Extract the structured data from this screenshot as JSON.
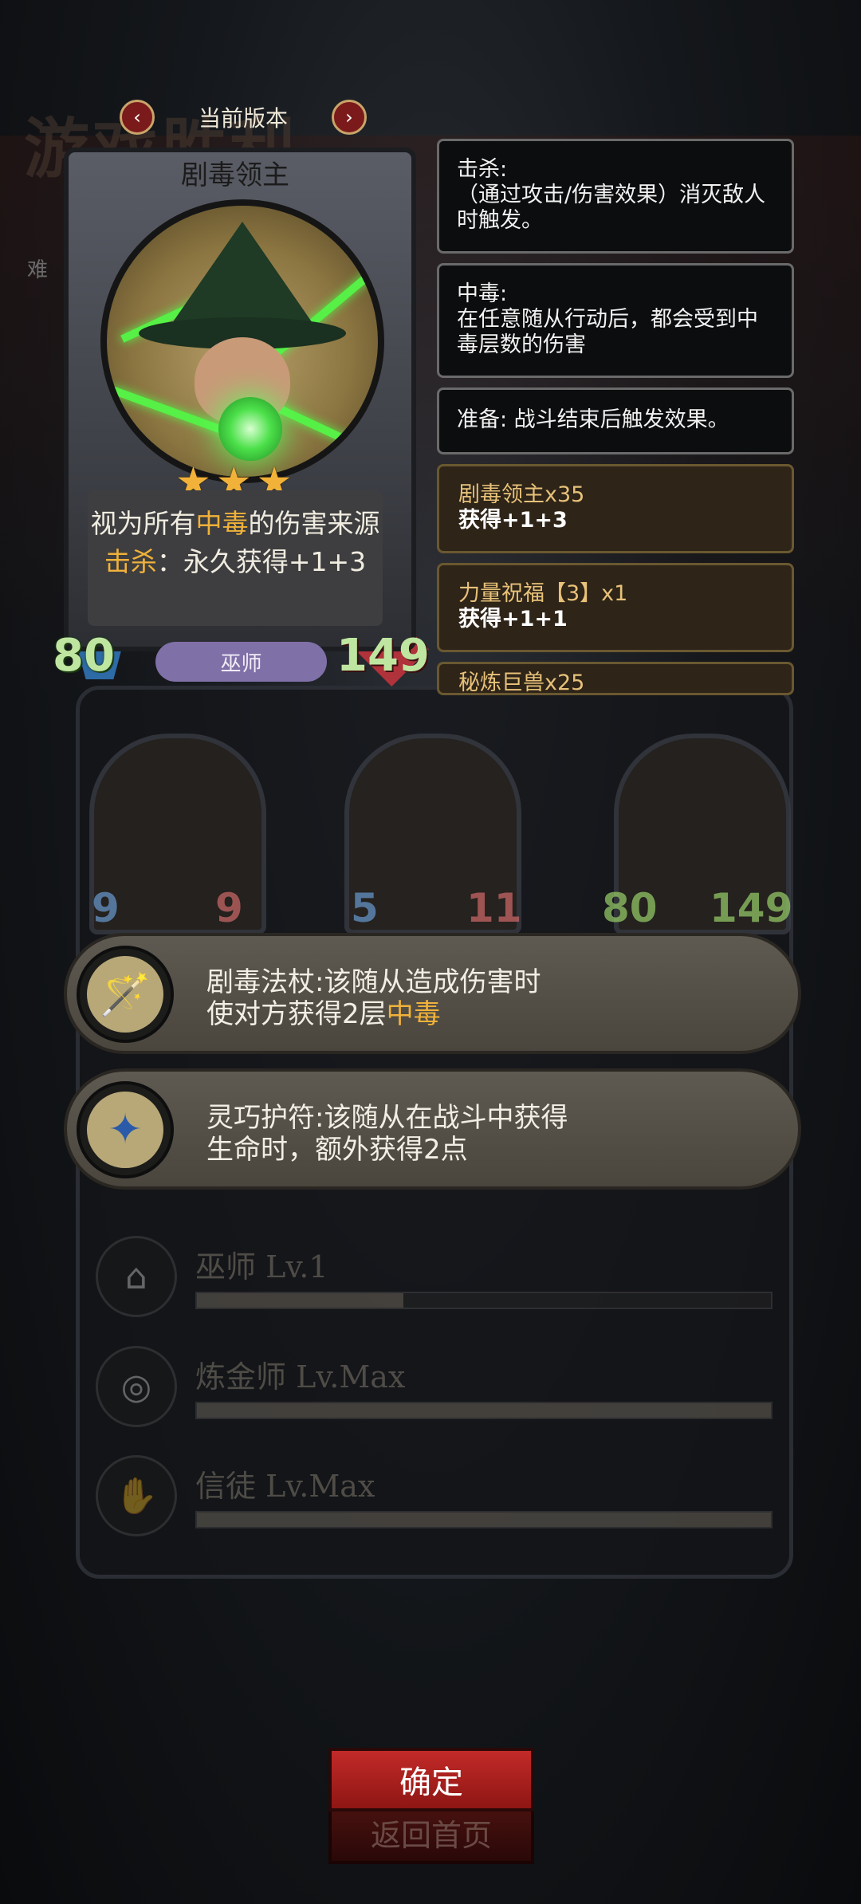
{
  "background": {
    "title": "游戏胜利",
    "subtitle": "难"
  },
  "version": {
    "label": "当前版本",
    "prev_icon": "chevron-left",
    "next_icon": "chevron-right"
  },
  "card": {
    "name": "剧毒领主",
    "stars": 3,
    "desc_line1_pre": "视为所有",
    "desc_line1_hl": "中毒",
    "desc_line1_post": "的伤害来源",
    "desc_line2_hl": "击杀",
    "desc_line2_post": "：永久获得+1+3",
    "attack": "80",
    "health": "149",
    "type": "巫师"
  },
  "keywords": [
    {
      "title": "击杀:",
      "text": "（通过攻击/伤害效果）消灭敌人时触发。"
    },
    {
      "title": "中毒:",
      "text": "在任意随从行动后，都会受到中毒层数的伤害"
    },
    {
      "title": "准备: 战斗结束后触发效果。",
      "text": ""
    }
  ],
  "bonuses": [
    {
      "title": "剧毒领主x35",
      "value": "获得+1+3"
    },
    {
      "title": "力量祝福【3】x1",
      "value": "获得+1+1"
    },
    {
      "title": "秘炼巨兽x25",
      "value": ""
    }
  ],
  "minions": [
    {
      "attack": "9",
      "health": "9"
    },
    {
      "attack": "5",
      "health": "11"
    },
    {
      "attack": "80",
      "health": "149"
    }
  ],
  "items": [
    {
      "line1": "剧毒法杖:该随从造成伤害时",
      "line2_pre": "使对方获得2层",
      "line2_hl": "中毒",
      "icon": "staff-icon"
    },
    {
      "line1": "灵巧护符:该随从在战斗中获得",
      "line2_pre": "生命时，额外获得2点",
      "line2_hl": "",
      "icon": "amulet-icon"
    }
  ],
  "skills": [
    {
      "name": "巫师 Lv.1",
      "progress": 0.36,
      "icon": "wizard-hat-icon"
    },
    {
      "name": "炼金师 Lv.Max",
      "progress": 1.0,
      "icon": "alchemy-icon"
    },
    {
      "name": "信徒 Lv.Max",
      "progress": 1.0,
      "icon": "praying-hands-icon"
    }
  ],
  "buttons": {
    "confirm": "确定",
    "home": "返回首页"
  },
  "colors": {
    "highlight": "#f0b23a",
    "confirm": "#c22a28",
    "type_pill": "#8070a8"
  }
}
